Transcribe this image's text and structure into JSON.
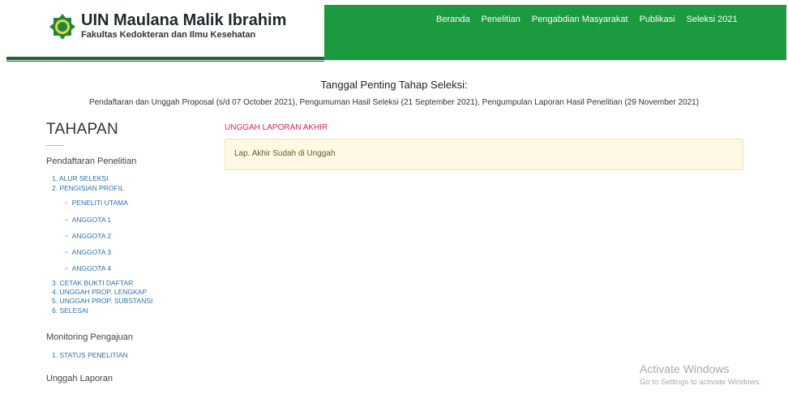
{
  "header": {
    "title": "UIN Maulana Malik Ibrahim",
    "subtitle": "Fakultas Kedokteran dan Ilmu Kesehatan",
    "nav": [
      "Beranda",
      "Penelitian",
      "Pengabdian Masyarakat",
      "Publikasi",
      "Seleksi 2021"
    ]
  },
  "dates": {
    "title": "Tanggal Penting Tahap Seleksi:",
    "text": "Pendaftaran dan Unggah Proposal (s/d 07 October 2021), Pengumuman Hasil Seleksi (21 September 2021), Pengumpulan Laporan Hasil Penelitian (29 November 2021)"
  },
  "sidebar": {
    "title": "TAHAPAN",
    "sections": [
      {
        "heading": "Pendaftaran Penelitian"
      },
      {
        "heading": "Monitoring Pengajuan"
      },
      {
        "heading": "Unggah Laporan"
      }
    ],
    "steps": [
      "1. ALUR SELEKSI",
      "2. PENGISIAN PROFIL",
      "3. CETAK BUKTI DAFTAR",
      "4. UNGGAH PROP. LENGKAP",
      "5. UNGGAH PROP. SUBSTANSI",
      "6. SELESAI"
    ],
    "profile_items": [
      "PENELITI UTAMA",
      "ANGGOTA 1",
      "ANGGOTA 2",
      "ANGGOTA 3",
      "ANGGOTA 4"
    ],
    "monitoring_items": [
      "1. STATUS PENELITIAN"
    ]
  },
  "main": {
    "heading": "UNGGAH LAPORAN AKHIR",
    "alert": "Lap. Akhir Sudah di Unggah"
  },
  "watermark": {
    "title": "Activate Windows",
    "subtitle": "Go to Settings to activate Windows."
  },
  "colors": {
    "header_green": "#1b9a3f",
    "link_blue": "#2d6fae",
    "heading_pink": "#e0245e",
    "alert_bg": "#fcf8e3"
  }
}
